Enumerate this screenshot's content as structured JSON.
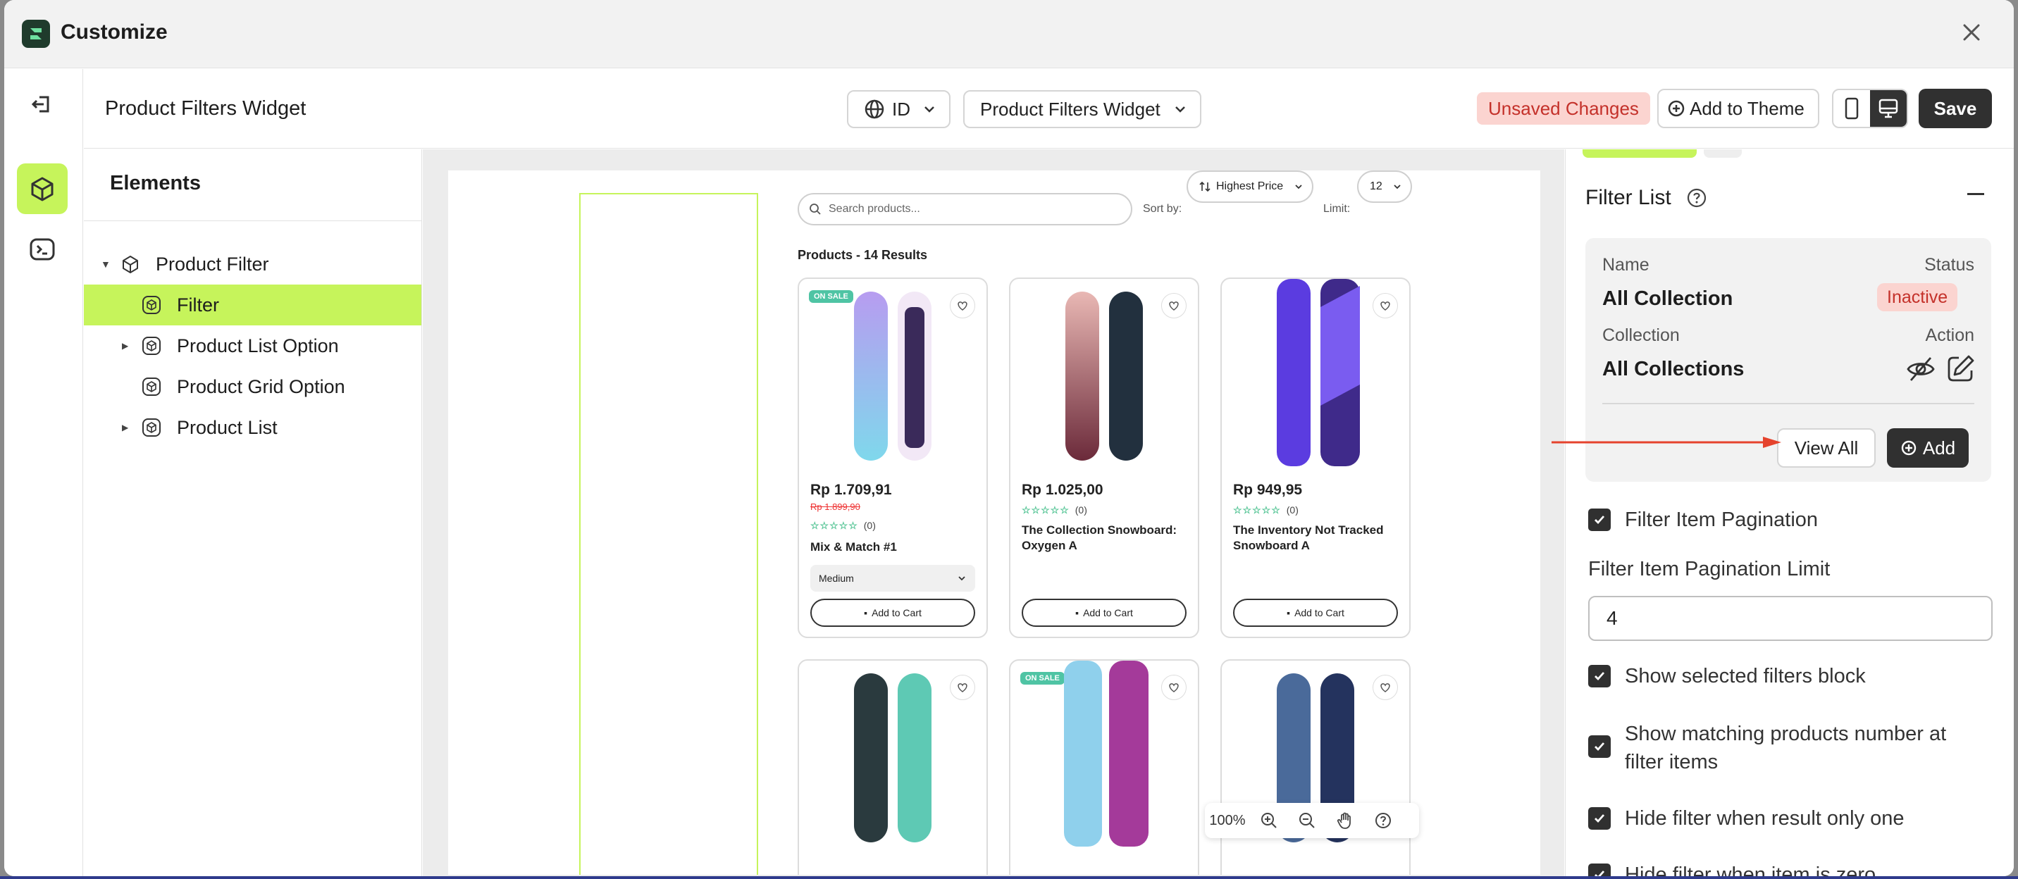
{
  "window": {
    "title": "Customize"
  },
  "topbar": {
    "page_title": "Product Filters Widget",
    "language": "ID",
    "widget_select": "Product Filters Widget",
    "unsaved_badge": "Unsaved Changes",
    "add_to_theme": "Add to Theme",
    "save": "Save"
  },
  "elements": {
    "title": "Elements",
    "tree": [
      {
        "label": "Product Filter"
      },
      {
        "label": "Filter"
      },
      {
        "label": "Product List Option"
      },
      {
        "label": "Product Grid Option"
      },
      {
        "label": "Product List"
      }
    ]
  },
  "preview": {
    "search_placeholder": "Search products...",
    "sort_label": "Sort by:",
    "sort_value": "Highest Price",
    "limit_label": "Limit:",
    "limit_value": "12",
    "results_text": "Products - 14 Results",
    "sale_badge": "ON SALE",
    "add_to_cart": "Add to Cart",
    "stars": "☆☆☆☆☆",
    "rating_count": "(0)",
    "zoom": "100%",
    "products": [
      {
        "price": "Rp 1.709,91",
        "compare_price": "Rp 1.899,90",
        "name": "Mix & Match #1",
        "variant": "Medium"
      },
      {
        "price": "Rp 1.025,00",
        "name": "The Collection Snowboard: Oxygen A"
      },
      {
        "price": "Rp 949,95",
        "name": "The Inventory Not Tracked Snowboard A"
      }
    ]
  },
  "panel": {
    "section_title": "Filter List",
    "name_label": "Name",
    "status_label": "Status",
    "name_value": "All Collection",
    "status_value": "Inactive",
    "collection_label": "Collection",
    "action_label": "Action",
    "collection_value": "All Collections",
    "view_all": "View All",
    "add": "Add",
    "checks": [
      "Filter Item Pagination",
      "Show selected filters block",
      "Show matching products number at filter items",
      "Hide filter when result only one",
      "Hide filter when item is zero"
    ],
    "limit_label": "Filter Item Pagination Limit",
    "limit_value": "4"
  },
  "colors": {
    "accent": "#c6f45b",
    "dark": "#303030",
    "danger_bg": "#fbd4d0",
    "danger_text": "#c4312a",
    "arrow": "#e5432d"
  }
}
